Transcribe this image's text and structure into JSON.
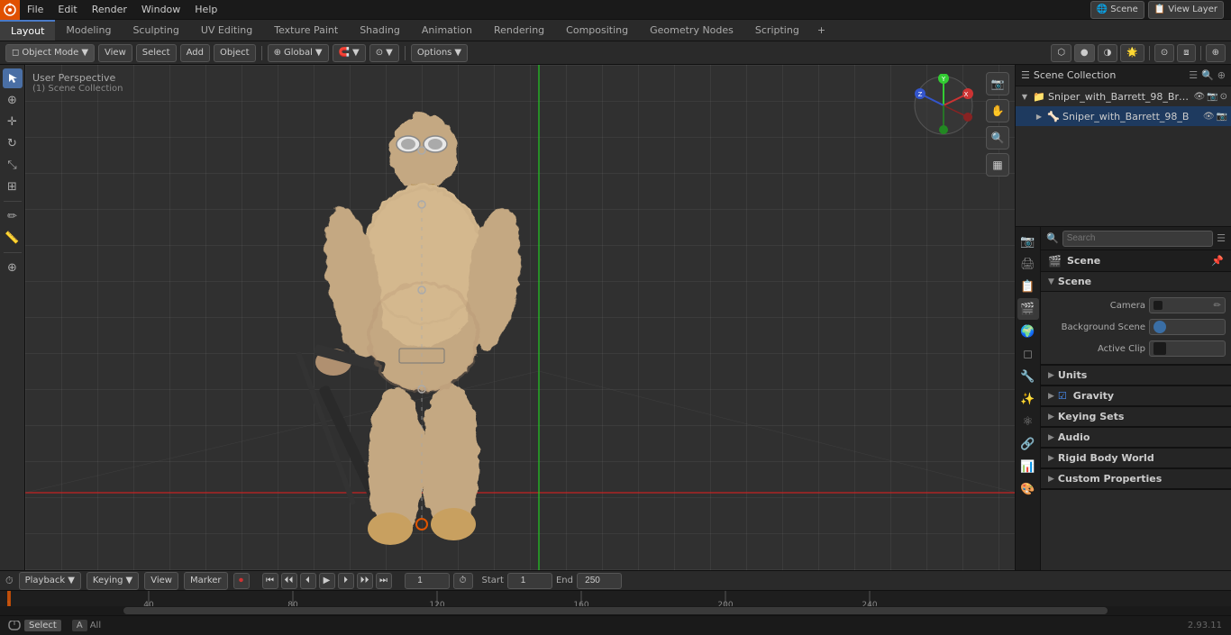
{
  "app": {
    "title": "Blender",
    "version": "2.93.11"
  },
  "menu": {
    "items": [
      "File",
      "Edit",
      "Render",
      "Window",
      "Help"
    ]
  },
  "workspace_tabs": {
    "tabs": [
      "Layout",
      "Modeling",
      "Sculpting",
      "UV Editing",
      "Texture Paint",
      "Shading",
      "Animation",
      "Rendering",
      "Compositing",
      "Geometry Nodes",
      "Scripting"
    ],
    "active": "Layout"
  },
  "viewport": {
    "mode": "Object Mode",
    "perspective_label": "User Perspective",
    "collection_label": "(1) Scene Collection",
    "shading_mode": "Solid",
    "overlay_options": "Options",
    "transform": "Global"
  },
  "outliner": {
    "title": "Scene Collection",
    "items": [
      {
        "name": "Sniper_with_Barrett_98_Brav...",
        "type": "collection",
        "expanded": true,
        "indent": 0
      },
      {
        "name": "Sniper_with_Barrett_98_B",
        "type": "mesh",
        "expanded": false,
        "indent": 1
      }
    ]
  },
  "properties": {
    "search_placeholder": "Search",
    "active_tab": "scene",
    "scene_header": "Scene",
    "scene_label": "Scene",
    "sections": [
      {
        "id": "scene",
        "label": "Scene",
        "expanded": true,
        "rows": [
          {
            "label": "Camera",
            "value": "",
            "icon": "camera"
          },
          {
            "label": "Background Scene",
            "value": "",
            "icon": "scene"
          },
          {
            "label": "Active Clip",
            "value": "",
            "icon": "clip"
          }
        ]
      },
      {
        "id": "units",
        "label": "Units",
        "expanded": false
      },
      {
        "id": "gravity",
        "label": "Gravity",
        "expanded": false,
        "checked": true
      },
      {
        "id": "keying_sets",
        "label": "Keying Sets",
        "expanded": false
      },
      {
        "id": "audio",
        "label": "Audio",
        "expanded": false
      },
      {
        "id": "rigid_body_world",
        "label": "Rigid Body World",
        "expanded": false
      },
      {
        "id": "custom_properties",
        "label": "Custom Properties",
        "expanded": false
      }
    ]
  },
  "timeline": {
    "playback_label": "Playback",
    "keying_label": "Keying",
    "view_label": "View",
    "marker_label": "Marker",
    "current_frame": "1",
    "start_label": "Start",
    "start_frame": "1",
    "end_label": "End",
    "end_frame": "250",
    "frame_markers": [
      1,
      40,
      80,
      120,
      160,
      200,
      240
    ],
    "tick_labels": [
      "1",
      "40",
      "80",
      "120",
      "160",
      "200",
      "240"
    ]
  },
  "status_bar": {
    "select_label": "Select",
    "version": "2.93.11"
  },
  "icons": {
    "arrow_right": "▶",
    "arrow_down": "▼",
    "expand": "▶",
    "collapse": "▼",
    "camera": "📷",
    "scene": "🎬",
    "mesh": "◻",
    "collection": "📁",
    "eye": "👁",
    "dot": "●",
    "gear": "⚙",
    "search": "🔍",
    "checkbox_on": "☑",
    "checkbox_off": "☐",
    "play": "▶",
    "rewind": "⏮",
    "prev_frame": "⏴",
    "next_frame": "⏵",
    "fast_forward": "⏭",
    "prev_keyframe": "◀◀",
    "next_keyframe": "▶▶",
    "record": "⏺",
    "lock": "🔒",
    "render": "🎥",
    "compositor": "🔷",
    "filter": "☰"
  }
}
